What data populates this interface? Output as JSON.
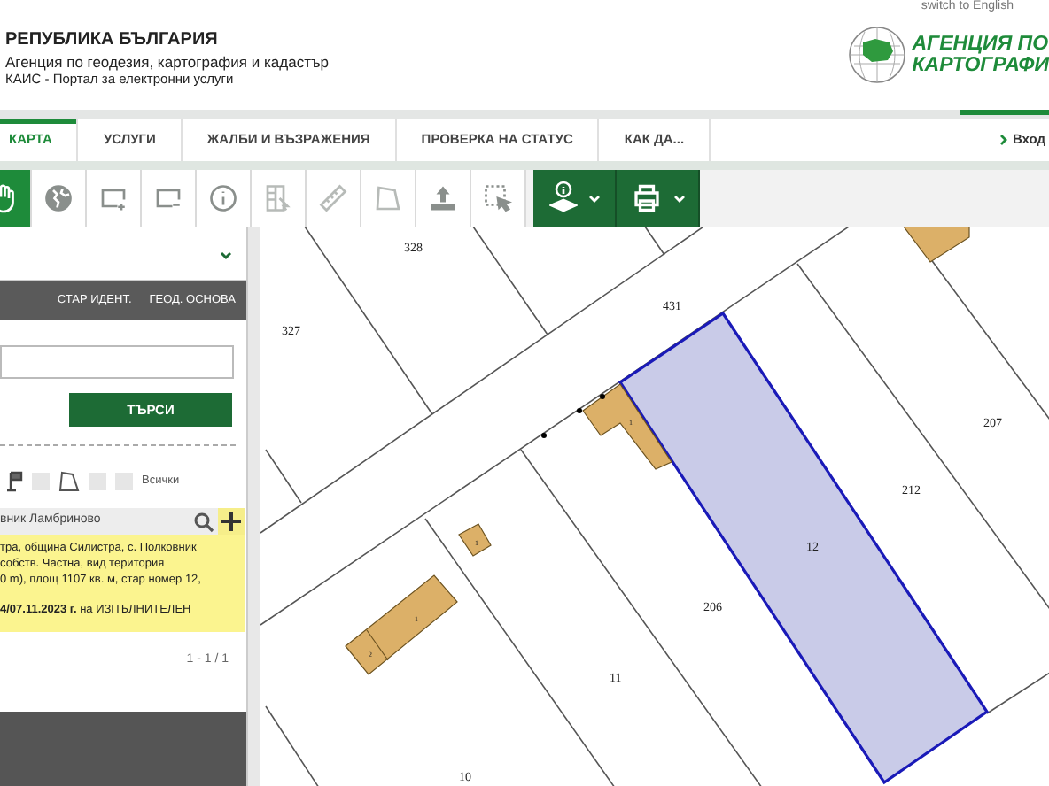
{
  "header": {
    "language_link": "switch to English",
    "title": "РЕПУБЛИКА БЪЛГАРИЯ",
    "subtitle": "Агенция по геодезия, картография и кадастър",
    "portal": "КАИС - Портал за електронни услуги",
    "logo_lines": [
      "АГЕНЦИЯ ПО",
      "КАРТОГРАФИ"
    ]
  },
  "nav": {
    "tabs": [
      {
        "label": "КАРТА",
        "selected": true
      },
      {
        "label": "УСЛУГИ",
        "selected": false
      },
      {
        "label": "ЖАЛБИ И ВЪЗРАЖЕНИЯ",
        "selected": false
      },
      {
        "label": "ПРОВЕРКА НА СТАТУС",
        "selected": false
      },
      {
        "label": "КАК ДА...",
        "selected": false
      }
    ],
    "login": "Вход"
  },
  "toolbar": {
    "tools": [
      {
        "kind": "hand",
        "selected": true
      },
      {
        "kind": "globe",
        "selected": false
      },
      {
        "kind": "zoom-in",
        "selected": false
      },
      {
        "kind": "zoom-out",
        "selected": false
      },
      {
        "kind": "info",
        "selected": false
      },
      {
        "kind": "grid",
        "selected": false
      },
      {
        "kind": "ruler",
        "selected": false
      },
      {
        "kind": "polygon",
        "selected": false
      },
      {
        "kind": "upload",
        "selected": false
      },
      {
        "kind": "select",
        "selected": false
      }
    ],
    "menus": [
      {
        "kind": "layers"
      },
      {
        "kind": "print"
      }
    ]
  },
  "panel": {
    "tabs": [
      {
        "label": "СТАР ИДЕНТ.",
        "selected": false
      },
      {
        "label": "ГЕОД. ОСНОВА",
        "selected": false
      }
    ],
    "search_button": "ТЪРСИ",
    "filters": [
      {
        "kind": "flag",
        "checked": false
      },
      {
        "kind": "polygon",
        "checked": false
      },
      {
        "kind": "all",
        "label": "Всички",
        "checked": false
      }
    ],
    "result_field": "вник Ламбриново",
    "result_lines": [
      "тра, община Силистра, с. Полковник",
      "собств. Частна, вид територия",
      "0 m), площ 1107 кв. м, стар номер 12,",
      "**4/07.11.2023 г.** на ИЗПЪЛНИТЕЛЕН"
    ],
    "pager": "1 - 1 / 1"
  },
  "map": {
    "parcel_labels": [
      "328",
      "327",
      "431",
      "207",
      "212",
      "12",
      "206",
      "11",
      "10"
    ],
    "building_labels": [
      "1",
      "1",
      "1",
      "2"
    ]
  }
}
